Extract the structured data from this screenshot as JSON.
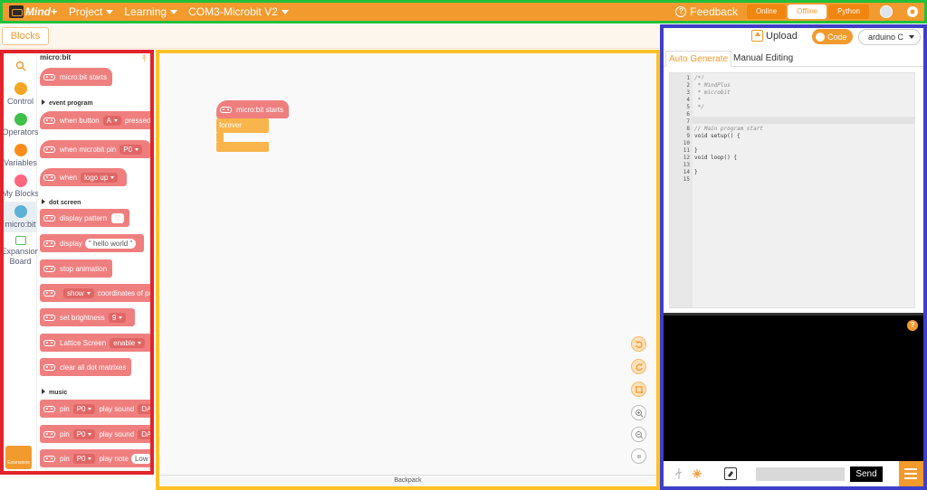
{
  "topbar": {
    "logo_text": "Mind+",
    "menus": [
      "Project",
      "Learning",
      "COM3-Microbit V2"
    ],
    "feedback": "Feedback",
    "modes": [
      "Online",
      "Offline",
      "Python"
    ],
    "active_mode": "Offline",
    "accent": "#f29a2e"
  },
  "tabs": {
    "blocks": "Blocks"
  },
  "categories": [
    {
      "label": "",
      "icon": "search-icon",
      "color": "#f29a2e"
    },
    {
      "label": "Control",
      "color": "#f5a623"
    },
    {
      "label": "Operators",
      "color": "#40bf4a"
    },
    {
      "label": "Variables",
      "color": "#ff8c1a"
    },
    {
      "label": "My Blocks",
      "color": "#ff6680"
    },
    {
      "label": "micro:bit",
      "color": "#5cb1d6",
      "selected": true
    },
    {
      "label": "Expansion Board",
      "color": "#59c059"
    }
  ],
  "extensions_label": "Extensions",
  "palette": {
    "title": "micro:bit",
    "starts": "micro:bit starts",
    "sec_event": "event program",
    "when_button": "when button",
    "btn_val": "A",
    "pressed": "pressed",
    "when_pin": "when microbit pin",
    "pin_val": "P0",
    "when": "when",
    "logo_up": "logo up",
    "sec_dot": "dot screen",
    "display_pattern": "display pattern",
    "display": "display",
    "hello": "\" hello world \"",
    "stop_anim": "stop animation",
    "show": "show",
    "coords": "coordinates of point",
    "set_brightness": "set brightness",
    "bright_val": "9",
    "lattice": "Lattice Screen",
    "enable": "enable",
    "clear": "clear all dot matrixes",
    "sec_music": "music",
    "pin": "pin",
    "p0": "P0",
    "play_sound": "play sound",
    "da": "DADADADUM",
    "play_note": "play note",
    "low": "Low"
  },
  "workspace": {
    "hat": "micro:bit starts",
    "forever": "forever",
    "backpack": "Backpack"
  },
  "right": {
    "upload": "Upload",
    "code": "Code",
    "language": "arduino C",
    "tab_auto": "Auto Generate",
    "tab_manual": "Manual Editing",
    "code_lines": [
      {
        "n": "1",
        "t": "/*!",
        "c": true
      },
      {
        "n": "2",
        "t": " * MindPlus",
        "c": true
      },
      {
        "n": "3",
        "t": " * microbit",
        "c": true
      },
      {
        "n": "4",
        "t": " *",
        "c": true
      },
      {
        "n": "5",
        "t": " */",
        "c": true
      },
      {
        "n": "6",
        "t": "",
        "c": false
      },
      {
        "n": "7",
        "t": "",
        "c": false
      },
      {
        "n": "8",
        "t": "// Main program start",
        "c": true
      },
      {
        "n": "9",
        "t": "void setup() {",
        "c": false
      },
      {
        "n": "10",
        "t": "",
        "c": false
      },
      {
        "n": "11",
        "t": "}",
        "c": false
      },
      {
        "n": "12",
        "t": "void loop() {",
        "c": false
      },
      {
        "n": "13",
        "t": "",
        "c": false
      },
      {
        "n": "14",
        "t": "}",
        "c": false
      },
      {
        "n": "15",
        "t": "",
        "c": false
      }
    ],
    "send": "Send",
    "help": "?"
  }
}
